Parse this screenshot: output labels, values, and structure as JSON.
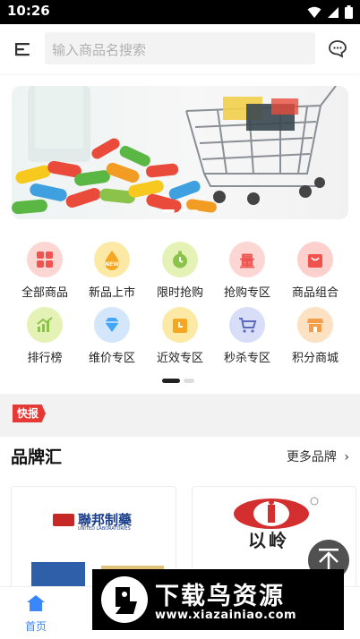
{
  "status_bar": {
    "time": "10:26"
  },
  "search": {
    "placeholder": "输入商品名搜索"
  },
  "categories": [
    {
      "label": "全部商品",
      "icon": "grid-icon",
      "color": "#fbd6d3",
      "fg": "#ef5350"
    },
    {
      "label": "新品上市",
      "icon": "new-icon",
      "color": "#fde9a6",
      "fg": "#f5a623"
    },
    {
      "label": "限时抢购",
      "icon": "stopwatch-icon",
      "color": "#e4f2b5",
      "fg": "#8bc34a"
    },
    {
      "label": "抢购专区",
      "icon": "quantity-icon",
      "color": "#fbd6d3",
      "fg": "#ef5350"
    },
    {
      "label": "商品组合",
      "icon": "bag-icon",
      "color": "#fbd0cd",
      "fg": "#f0524d"
    },
    {
      "label": "排行榜",
      "icon": "chart-icon",
      "color": "#e4f2b5",
      "fg": "#8bc34a"
    },
    {
      "label": "维价专区",
      "icon": "diamond-icon",
      "color": "#d3e6fb",
      "fg": "#42a5f5"
    },
    {
      "label": "近效专区",
      "icon": "calendar-icon",
      "color": "#fde9a6",
      "fg": "#f5a623"
    },
    {
      "label": "秒杀专区",
      "icon": "cart-icon",
      "color": "#d9def8",
      "fg": "#5c6bc0"
    },
    {
      "label": "积分商城",
      "icon": "store-icon",
      "color": "#fde1c3",
      "fg": "#f39c4a"
    }
  ],
  "news": {
    "badge": "快报"
  },
  "brands": {
    "title": "品牌汇",
    "more": "更多品牌",
    "items": [
      {
        "logo_text": "聯邦制藥",
        "logo_sub": "UNITED LABORATORIES"
      },
      {
        "logo_text": "以岭"
      }
    ]
  },
  "tabbar": {
    "home_label": "首页"
  },
  "watermark": {
    "text": "下载鸟资源",
    "url": "www.xiazainiao.com"
  }
}
